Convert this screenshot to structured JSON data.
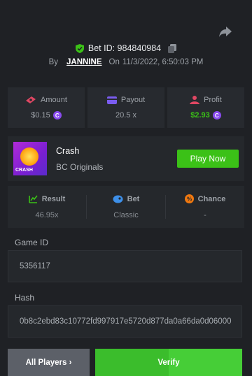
{
  "header": {
    "bet_id_label": "Bet ID: 984840984",
    "by_label": "By",
    "username": "JANNINE",
    "on_label": "On",
    "timestamp": "11/3/2022, 6:50:03 PM"
  },
  "stats": {
    "amount": {
      "label": "Amount",
      "value": "$0.15",
      "icon": "money-icon",
      "color": "#e04763"
    },
    "payout": {
      "label": "Payout",
      "value": "20.5 x",
      "icon": "card-icon",
      "color": "#7a5cf0"
    },
    "profit": {
      "label": "Profit",
      "value": "$2.93",
      "icon": "profit-icon",
      "color": "#e04763",
      "value_color": "#3bc117"
    }
  },
  "game": {
    "thumb_tag": "CRASH",
    "title": "Crash",
    "subtitle": "BC Originals",
    "play_label": "Play Now"
  },
  "result_stats": {
    "result": {
      "label": "Result",
      "value": "46.95x",
      "icon": "result-icon",
      "color": "#3bc117"
    },
    "bet": {
      "label": "Bet",
      "value": "Classic",
      "icon": "bet-icon",
      "color": "#3d8fe8"
    },
    "chance": {
      "label": "Chance",
      "value": "-",
      "icon": "chance-icon",
      "color": "#f0780f"
    }
  },
  "fields": {
    "game_id_label": "Game ID",
    "game_id_value": "5356117",
    "hash_label": "Hash",
    "hash_value": "0b8c2ebd83c10772fd997917e5720d877da0a66da0d06000"
  },
  "actions": {
    "all_players_label": "All Players ›",
    "verify_label": "Verify"
  },
  "colors": {
    "accent_green": "#3bc117",
    "background": "#1f2125",
    "panel": "#25282c"
  }
}
